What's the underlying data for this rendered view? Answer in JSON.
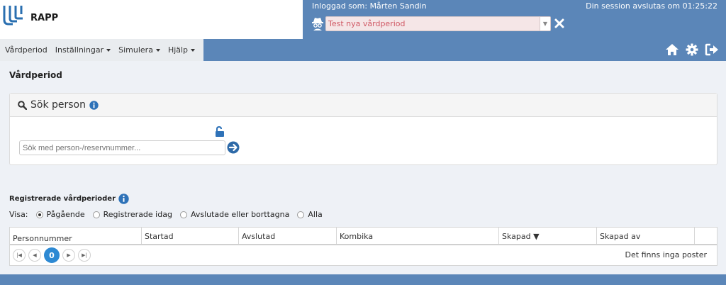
{
  "app": {
    "name": "RAPP"
  },
  "session": {
    "logged_in_as": "Inloggad som: Mårten Sandin",
    "expires": "Din session avslutas om 01:25:22"
  },
  "context_select": {
    "value": "Test nya vårdperiod"
  },
  "nav": {
    "items": [
      {
        "label": "Vårdperiod",
        "dropdown": false
      },
      {
        "label": "Inställningar",
        "dropdown": true
      },
      {
        "label": "Simulera",
        "dropdown": true
      },
      {
        "label": "Hjälp",
        "dropdown": true
      }
    ],
    "icons": [
      "home-icon",
      "gear-icon",
      "logout-icon"
    ]
  },
  "page": {
    "title": "Vårdperiod"
  },
  "search_panel": {
    "title": "Sök person",
    "placeholder": "Sök med person-/reservnummer..."
  },
  "registered": {
    "title": "Registrerade vårdperioder",
    "filter_label": "Visa:",
    "filters": [
      {
        "label": "Pågående",
        "selected": true
      },
      {
        "label": "Registrerade idag",
        "selected": false
      },
      {
        "label": "Avslutade eller borttagna",
        "selected": false
      },
      {
        "label": "Alla",
        "selected": false
      }
    ]
  },
  "grid": {
    "columns": [
      "Personnummer",
      "Startad",
      "Avslutad",
      "Kombika",
      "Skapad ▼",
      "Skapad av",
      ""
    ],
    "current_page": "0",
    "empty_text": "Det finns inga poster"
  },
  "colors": {
    "accent": "#5b86b8",
    "page_button": "#2d89d3",
    "select_bg": "#f5e6e7",
    "select_text": "#d05a66"
  }
}
